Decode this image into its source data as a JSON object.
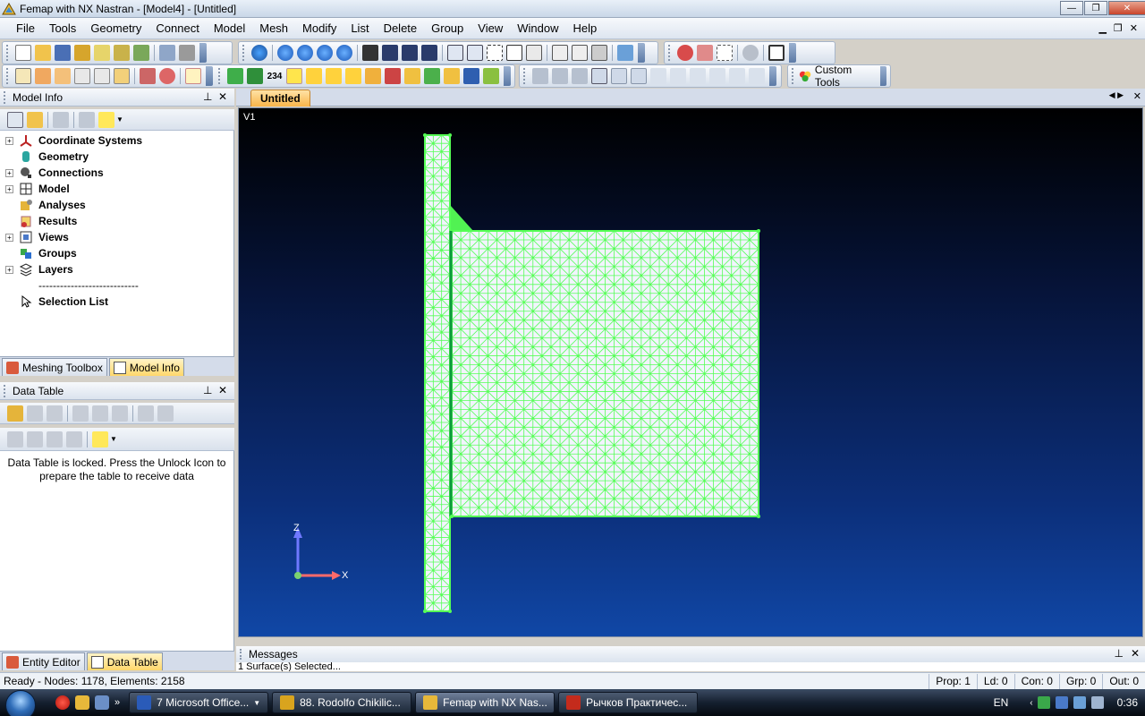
{
  "window": {
    "title": "Femap with NX Nastran - [Model4] - [Untitled]",
    "minimize": "—",
    "restore": "❐",
    "close": "✕"
  },
  "menu": [
    "File",
    "Tools",
    "Geometry",
    "Connect",
    "Model",
    "Mesh",
    "Modify",
    "List",
    "Delete",
    "Group",
    "View",
    "Window",
    "Help"
  ],
  "toolbar": {
    "custom_tools_label": "Custom Tools",
    "numbering_label": "234"
  },
  "model_info": {
    "title": "Model Info",
    "tree": [
      {
        "label": "Coordinate Systems",
        "icon": "axes-icon",
        "expand": "+"
      },
      {
        "label": "Geometry",
        "icon": "cylinder-icon",
        "expand": ""
      },
      {
        "label": "Connections",
        "icon": "connector-icon",
        "expand": "+"
      },
      {
        "label": "Model",
        "icon": "mesh-grid-icon",
        "expand": "+"
      },
      {
        "label": "Analyses",
        "icon": "analysis-icon",
        "expand": ""
      },
      {
        "label": "Results",
        "icon": "results-icon",
        "expand": ""
      },
      {
        "label": "Views",
        "icon": "view-icon",
        "expand": "+"
      },
      {
        "label": "Groups",
        "icon": "group-icon",
        "expand": ""
      },
      {
        "label": "Layers",
        "icon": "layers-icon",
        "expand": "+"
      },
      {
        "label": "----------------------------",
        "icon": "",
        "expand": ""
      },
      {
        "label": "Selection List",
        "icon": "cursor-icon",
        "expand": ""
      }
    ]
  },
  "left_tabs_top": [
    "Meshing Toolbox",
    "Model Info"
  ],
  "data_table": {
    "title": "Data Table",
    "message": "Data Table is locked. Press the Unlock Icon to prepare the table to receive data"
  },
  "left_tabs_bottom": [
    "Entity Editor",
    "Data Table"
  ],
  "graphics": {
    "tab": "Untitled",
    "view_label": "V1",
    "axis_z": "Z",
    "axis_x": "X"
  },
  "messages": {
    "title": "Messages",
    "last_line": "1 Surface(s) Selected..."
  },
  "status": {
    "ready": "Ready - Nodes: 1178,  Elements: 2158",
    "prop": "Prop: 1",
    "ld": "Ld: 0",
    "con": "Con: 0",
    "grp": "Grp: 0",
    "out": "Out: 0"
  },
  "taskbar": {
    "buttons": [
      {
        "label": "7 Microsoft Office...",
        "icon_color": "#2a5bb8",
        "active": false
      },
      {
        "label": "88. Rodolfo Chikilic...",
        "icon_color": "#d9a41e",
        "active": false
      },
      {
        "label": "Femap with NX Nas...",
        "icon_color": "#e7b83a",
        "active": true
      },
      {
        "label": "Рычков Практичес...",
        "icon_color": "#c42b1c",
        "active": false
      }
    ],
    "lang": "EN",
    "time": "0:36"
  },
  "colors": {
    "mesh": "#55ff55",
    "mesh_dark": "#0c9a3c",
    "element_fill": "#f2f4ff",
    "accent_tab": "#f9b54a"
  }
}
